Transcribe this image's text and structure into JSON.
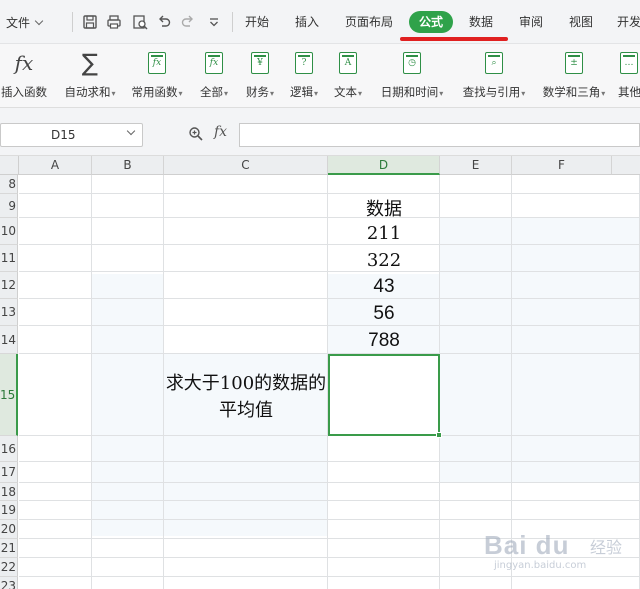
{
  "menu": {
    "file_label": "文件",
    "tabs": [
      {
        "label": "开始"
      },
      {
        "label": "插入"
      },
      {
        "label": "页面布局"
      },
      {
        "label": "公式"
      },
      {
        "label": "数据"
      },
      {
        "label": "审阅"
      },
      {
        "label": "视图"
      },
      {
        "label": "开发"
      }
    ],
    "active_tab": "公式",
    "accent_color": "#2fa24a",
    "annotation_color": "#e02020"
  },
  "ribbon": {
    "items": [
      {
        "label": "插入函数",
        "icon": "fx-icon"
      },
      {
        "label": "自动求和",
        "icon": "sigma-icon"
      },
      {
        "label": "常用函数",
        "icon": "star-function-icon"
      },
      {
        "label": "全部",
        "icon": "function-book-icon"
      },
      {
        "label": "财务",
        "icon": "finance-book-icon"
      },
      {
        "label": "逻辑",
        "icon": "logic-book-icon"
      },
      {
        "label": "文本",
        "icon": "text-book-icon"
      },
      {
        "label": "日期和时间",
        "icon": "clock-book-icon"
      },
      {
        "label": "查找与引用",
        "icon": "lookup-book-icon"
      },
      {
        "label": "数学和三角",
        "icon": "math-book-icon"
      },
      {
        "label": "其他",
        "icon": "more-book-icon"
      }
    ]
  },
  "formula_bar": {
    "name_box": "D15",
    "fx_label": "fx",
    "formula": ""
  },
  "grid": {
    "columns": [
      "A",
      "B",
      "C",
      "D",
      "E",
      "F"
    ],
    "rows": [
      "8",
      "9",
      "10",
      "11",
      "12",
      "13",
      "14",
      "15",
      "16",
      "17",
      "18",
      "19",
      "20",
      "21",
      "22",
      "23"
    ],
    "selected_column": "D",
    "selected_row": "15",
    "cells": {
      "D9": "数据",
      "D10": "211",
      "D11": "322",
      "D12": "43",
      "D13": "56",
      "D14": "788",
      "C15": "求大于100的数据的平均值"
    },
    "selected_cell": "D15"
  },
  "watermark": {
    "brand": "Bai du",
    "tag": "经验",
    "url": "jingyan.baidu.com"
  }
}
